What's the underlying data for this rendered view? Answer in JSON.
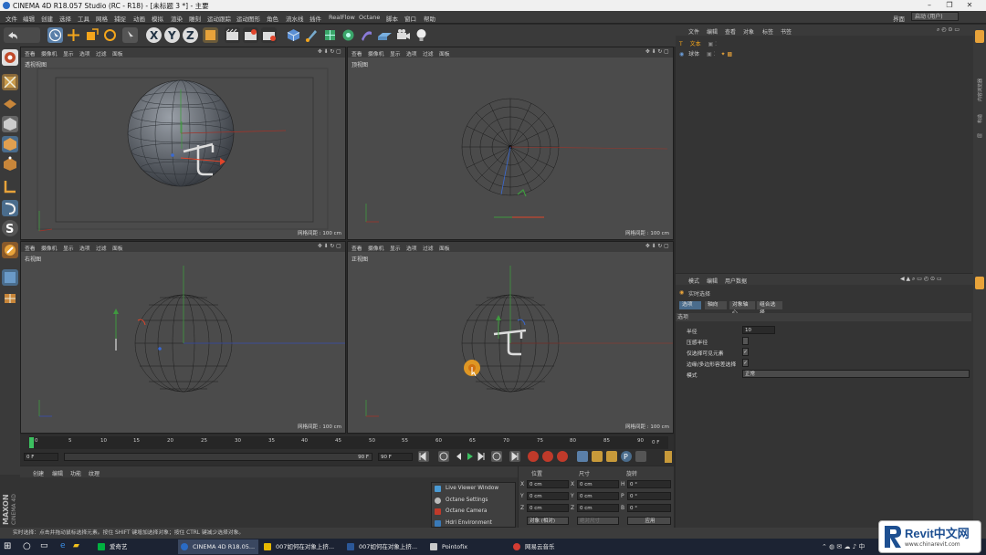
{
  "window": {
    "title": "CINEMA 4D R18.057 Studio (RC - R18) - [未标题 3 *] - 主要"
  },
  "menu": [
    "文件",
    "编辑",
    "创建",
    "选择",
    "工具",
    "网格",
    "捕捉",
    "动画",
    "模拟",
    "渲染",
    "雕刻",
    "运动跟踪",
    "运动图形",
    "角色",
    "流水线",
    "插件",
    "RealFlow",
    "Octane",
    "脚本",
    "窗口",
    "帮助"
  ],
  "layout": {
    "label": "界面",
    "value": "启动 (用户)"
  },
  "viewports": [
    {
      "name": "透视视图",
      "menu": [
        "查看",
        "摄像机",
        "显示",
        "选项",
        "过滤",
        "面板"
      ],
      "grid": "网格间距 : 100 cm"
    },
    {
      "name": "顶视图",
      "menu": [
        "查看",
        "摄像机",
        "显示",
        "选项",
        "过滤",
        "面板"
      ],
      "grid": "网格间距 : 100 cm"
    },
    {
      "name": "右视图",
      "menu": [
        "查看",
        "摄像机",
        "显示",
        "选项",
        "过滤",
        "面板"
      ],
      "grid": "网格间距 : 100 cm"
    },
    {
      "name": "正视图",
      "menu": [
        "查看",
        "摄像机",
        "显示",
        "选项",
        "过滤",
        "面板"
      ],
      "grid": "网格间距 : 100 cm"
    }
  ],
  "timeline": {
    "ticks": [
      "0",
      "5",
      "10",
      "15",
      "20",
      "25",
      "30",
      "35",
      "40",
      "45",
      "50",
      "55",
      "60",
      "65",
      "70",
      "75",
      "80",
      "85",
      "90"
    ],
    "current_frame": "0 F",
    "start": "0 F",
    "end": "90 F",
    "preview_end": "90 F",
    "right_field": "0 F"
  },
  "material": {
    "menu": [
      "创建",
      "编辑",
      "功能",
      "纹理"
    ]
  },
  "octane_menu": [
    "Live Viewer Window",
    "Octane Settings",
    "Octane Camera",
    "Hdri Environment"
  ],
  "coords": {
    "headers": [
      "位置",
      "尺寸",
      "旋转"
    ],
    "rows": [
      {
        "a": "X",
        "av": "0 cm",
        "b": "X",
        "bv": "0 cm",
        "c": "H",
        "cv": "0 °"
      },
      {
        "a": "Y",
        "av": "0 cm",
        "b": "Y",
        "bv": "0 cm",
        "c": "P",
        "cv": "0 °"
      },
      {
        "a": "Z",
        "av": "0 cm",
        "b": "Z",
        "bv": "0 cm",
        "c": "B",
        "cv": "0 °"
      }
    ],
    "mode": "对象 (相对)",
    "size_mode": "绝对尺寸",
    "apply": "应用"
  },
  "object_manager": {
    "menu": [
      "文件",
      "编辑",
      "查看",
      "对象",
      "标签",
      "书签"
    ],
    "items": [
      "文本",
      "球体"
    ]
  },
  "attributes": {
    "menu": [
      "模式",
      "编辑",
      "用户数据"
    ],
    "title": "实时选择",
    "tabs": [
      "选项",
      "轴向",
      "对象轴心",
      "组合选择"
    ],
    "section": "选项",
    "props": [
      {
        "label": "半径",
        "value": "10"
      },
      {
        "label": "压感半径",
        "value": ""
      },
      {
        "label": "仅选择可见元素",
        "value": "✓"
      },
      {
        "label": "边缘/多边形容差选择",
        "value": "✓"
      },
      {
        "label": "模式",
        "value": "正常"
      }
    ]
  },
  "side_tabs": [
    "对象",
    "内容浏览器",
    "构造",
    "层",
    "属性"
  ],
  "status": "实时选择：点击并拖动鼠标选择元素。按住 SHIFT 键增加选择对象；按住 CTRL 键减少选择对象。",
  "taskbar": [
    {
      "label": "爱奇艺",
      "color": "#00b140"
    },
    {
      "label": "CINEMA 4D R18.05...",
      "color": "#2a6bc4"
    },
    {
      "label": "007如何在对象上挤...",
      "color": "#e6b800"
    },
    {
      "label": "007如何在对象上挤...",
      "color": "#2b5797"
    },
    {
      "label": "Pointofix",
      "color": "#c8c8c8"
    },
    {
      "label": "网易云音乐",
      "color": "#d43c33"
    }
  ],
  "watermark": {
    "brand": "Revit中文网",
    "url": "www.chinarevit.com"
  },
  "colors": {
    "accent": "#4a6c8c",
    "viewport_bg": "#4b4b4b",
    "panel_bg": "#3a3a3a"
  }
}
